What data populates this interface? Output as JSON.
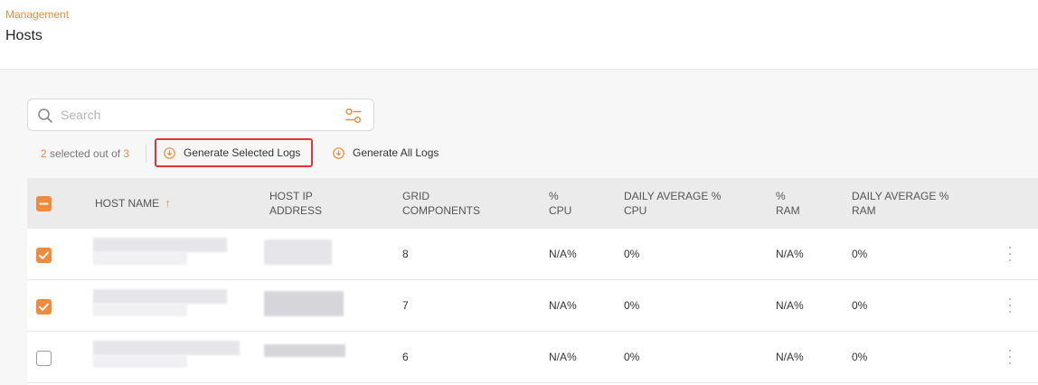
{
  "header": {
    "breadcrumb": "Management",
    "title": "Hosts"
  },
  "search": {
    "placeholder": "Search",
    "value": ""
  },
  "selection": {
    "selected": "2",
    "middle_text": " selected out of ",
    "total": "3"
  },
  "actions": {
    "generate_selected": "Generate Selected Logs",
    "generate_all": "Generate All Logs"
  },
  "table": {
    "headers": {
      "host_name": "HOST NAME",
      "host_ip_line1": "HOST IP",
      "host_ip_line2": "ADDRESS",
      "grid_line1": "GRID",
      "grid_line2": "COMPONENTS",
      "cpu_line1": "%",
      "cpu_line2": "CPU",
      "daily_cpu_line1": "DAILY AVERAGE %",
      "daily_cpu_line2": "CPU",
      "ram_line1": "%",
      "ram_line2": "RAM",
      "daily_ram_line1": "DAILY AVERAGE %",
      "daily_ram_line2": "RAM"
    },
    "rows": [
      {
        "checked": true,
        "grid_components": "8",
        "cpu": "N/A%",
        "daily_cpu": "0%",
        "ram": "N/A%",
        "daily_ram": "0%"
      },
      {
        "checked": true,
        "grid_components": "7",
        "cpu": "N/A%",
        "daily_cpu": "0%",
        "ram": "N/A%",
        "daily_ram": "0%"
      },
      {
        "checked": false,
        "grid_components": "6",
        "cpu": "N/A%",
        "daily_cpu": "0%",
        "ram": "N/A%",
        "daily_ram": "0%"
      }
    ]
  },
  "icons": {
    "search": "search-icon",
    "filter": "filter-sliders-icon",
    "download": "download-circle-icon",
    "sort": "sort-up-arrow-icon",
    "more": "kebab-menu-icon"
  },
  "colors": {
    "accent": "#f08a3c",
    "highlight_border": "#e0343a",
    "header_bg": "#ebebeb"
  }
}
